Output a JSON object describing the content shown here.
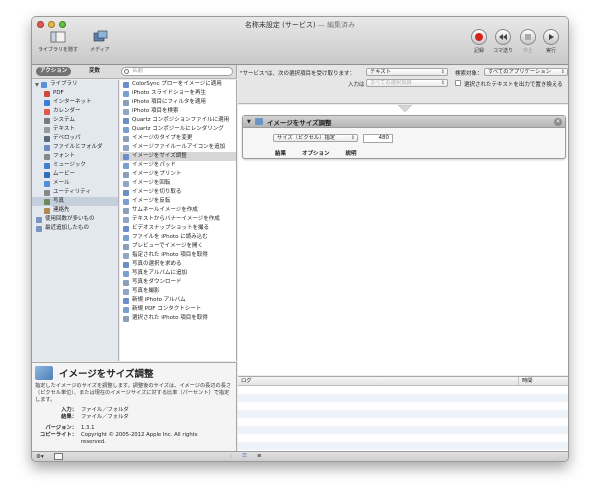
{
  "window": {
    "title": "名称未設定 (サービス)",
    "title_suffix": " — 編集済み"
  },
  "toolbar": {
    "library_label": "ライブラリを隠す",
    "media_label": "メディア",
    "record_label": "記録",
    "step_label": "コマ送り",
    "stop_label": "中止",
    "run_label": "実行"
  },
  "library_tabs": {
    "actions": "アクション",
    "variables": "変数"
  },
  "search": {
    "placeholder": "名前"
  },
  "categories": [
    {
      "label": "ライブラリ",
      "color": "#5b8fd6"
    },
    {
      "label": "PDF",
      "color": "#d04a3c"
    },
    {
      "label": "インターネット",
      "color": "#3a7fd5"
    },
    {
      "label": "カレンダー",
      "color": "#e05a4a"
    },
    {
      "label": "システム",
      "color": "#7a7a7a"
    },
    {
      "label": "テキスト",
      "color": "#999999"
    },
    {
      "label": "デベロッパ",
      "color": "#5a6a7a"
    },
    {
      "label": "ファイルとフォルダ",
      "color": "#6a8bbd"
    },
    {
      "label": "フォント",
      "color": "#888888"
    },
    {
      "label": "ミュージック",
      "color": "#3d7fd3"
    },
    {
      "label": "ムービー",
      "color": "#2e6fb8"
    },
    {
      "label": "メール",
      "color": "#4f8fd8"
    },
    {
      "label": "ユーティリティ",
      "color": "#888888"
    },
    {
      "label": "写真",
      "color": "#6a8a5a"
    },
    {
      "label": "連絡先",
      "color": "#b08a50"
    },
    {
      "label": "使用回数が多いもの",
      "color": "#7a93c0"
    },
    {
      "label": "最近追加したもの",
      "color": "#7a93c0"
    }
  ],
  "actions": [
    "ColorSync プローをイメージに適用",
    "iPhoto スライドショーを再生",
    "iPhoto 項目にフィルタを適用",
    "iPhoto 項目を検索",
    "Quartz コンポジションファイルに適用",
    "Quartz コンポジールにレンダリング",
    "イメージのタイプを変更",
    "イメージファイルールアイコンを追加",
    "イメージをサイズ調整",
    "イメージをパッド",
    "イメージをプリント",
    "イメージを回転",
    "イメージを切り取る",
    "イメージを反転",
    "サムネールイメージを作成",
    "テキストからバナーイメージを作成",
    "ビデオスナップショットを撮る",
    "ファイルを iPhoto に読み込む",
    "プレビューでイメージを開く",
    "指定された iPhoto 項目を取得",
    "写真の選択を求める",
    "写真をアルバムに追加",
    "写真をダウンロード",
    "写真を撮影",
    "新規 iPhoto アルバム",
    "新規 PDF コンタクトシート",
    "選択された iPhoto 項目を取得"
  ],
  "description": {
    "title": "イメージをサイズ調整",
    "text": "指定したイメージのサイズを調整します。調整後のサイズは、イメージの長辺の長さ（ピクセル単位）、または現在のイメージサイズに対する比率（パーセント）で指定します。",
    "input_label": "入力：",
    "input_value": "ファイル／フォルダ",
    "result_label": "結果：",
    "result_value": "ファイル／フォルダ",
    "version_label": "バージョン：",
    "version_value": "1.3.1",
    "copyright_label": "コピーライト：",
    "copyright_value": "Copyright © 2005-2012 Apple Inc.  All rights reserved."
  },
  "service_bar": {
    "receives_label": "\"サービス\"は、次の選択項目を受け取ります：",
    "receives_value": "テキスト",
    "target_label": "検索対象：",
    "target_value": "すべてのアプリケーション",
    "input_label": "入力は",
    "input_value": "すべての選択項目",
    "replace_label": "選択されたテキストを出力で置き換える"
  },
  "workflow_action": {
    "title": "イメージをサイズ調整",
    "mode_value": "サイズ（ピクセル）指定",
    "size_value": "480",
    "tab_results": "結果",
    "tab_options": "オプション",
    "tab_description": "説明"
  },
  "log": {
    "col_log": "ログ",
    "col_time": "時間"
  }
}
